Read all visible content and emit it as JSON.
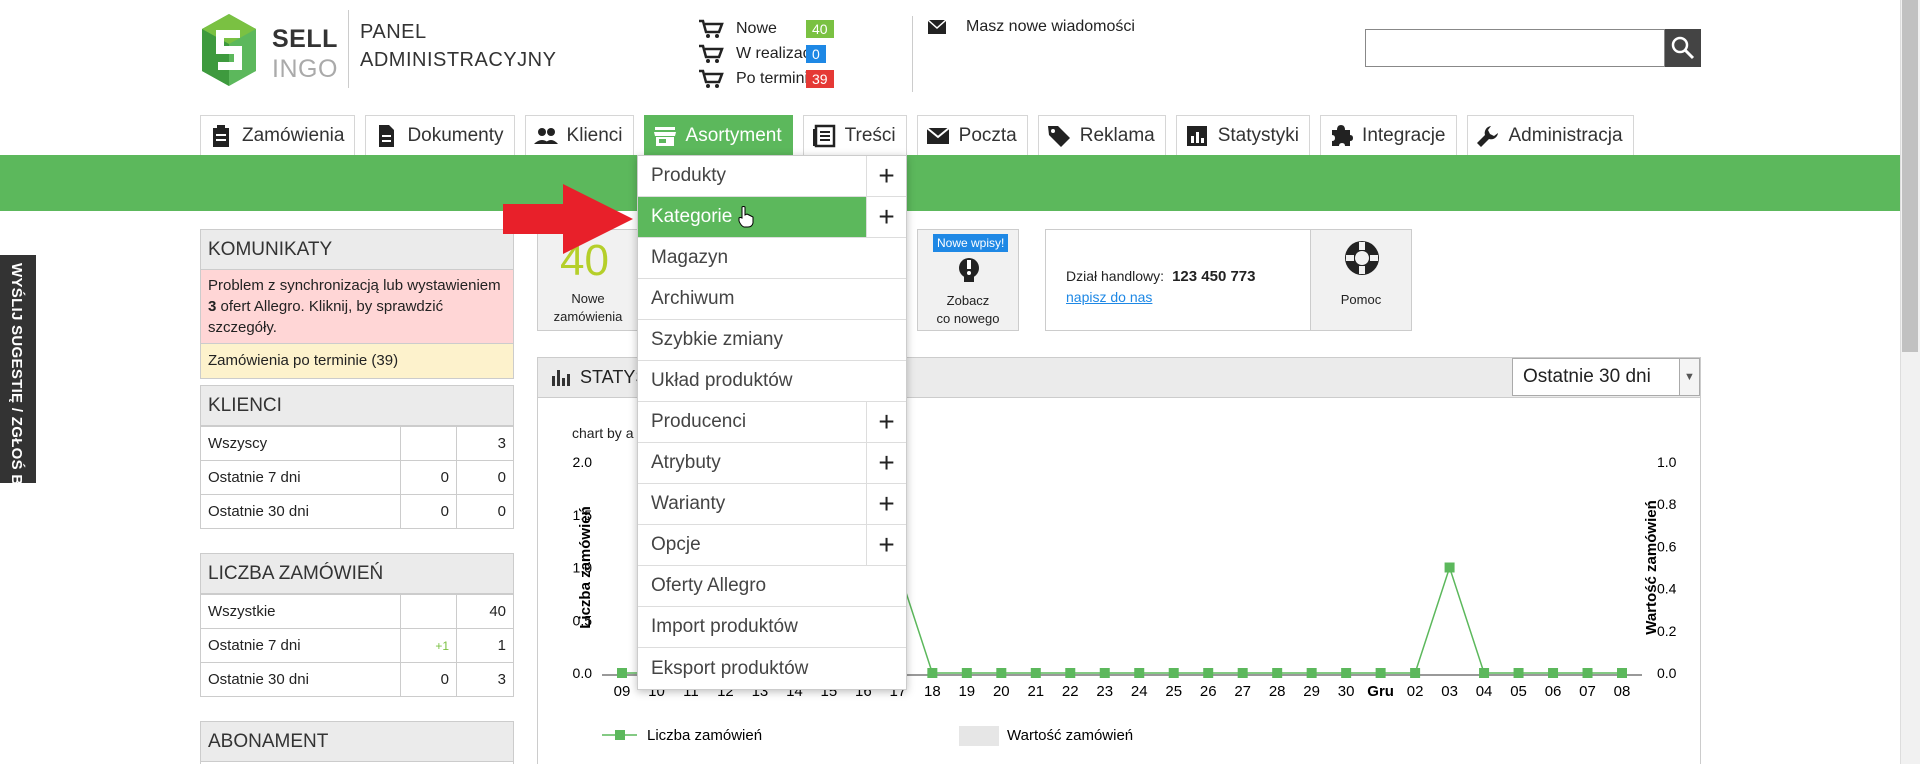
{
  "brand": {
    "logo_line1": "SELL",
    "logo_line2": "INGO",
    "panel_line1": "PANEL",
    "panel_line2": "ADMINISTRACYJNY"
  },
  "order_status": [
    {
      "label": "Nowe",
      "count": "40",
      "color": "#7ac142"
    },
    {
      "label": "W realizacji",
      "count": "0",
      "color": "#1e88e5"
    },
    {
      "label": "Po terminie",
      "count": "39",
      "color": "#e53935"
    }
  ],
  "messages": {
    "text": "Masz nowe wiadomości",
    "icon": "envelope-icon"
  },
  "search": {
    "value": "",
    "placeholder": "",
    "icon": "search-icon"
  },
  "nav": [
    {
      "label": "Zamówienia",
      "icon": "clipboard-icon"
    },
    {
      "label": "Dokumenty",
      "icon": "document-icon"
    },
    {
      "label": "Klienci",
      "icon": "people-icon"
    },
    {
      "label": "Asortyment",
      "icon": "store-icon",
      "active": true
    },
    {
      "label": "Treści",
      "icon": "list-icon"
    },
    {
      "label": "Poczta",
      "icon": "mail-icon"
    },
    {
      "label": "Reklama",
      "icon": "tag-icon"
    },
    {
      "label": "Statystyki",
      "icon": "chart-icon"
    },
    {
      "label": "Integracje",
      "icon": "puzzle-icon"
    },
    {
      "label": "Administracja",
      "icon": "wrench-icon"
    }
  ],
  "side_tab": "WYŚLIJ SUGESTIĘ / ZGŁOŚ BŁĄD",
  "komunikaty": {
    "title": "KOMUNIKATY",
    "alert_pre": "Problem z synchronizacją lub wystawieniem ",
    "alert_num": "3",
    "alert_post": " ofert Allegro. Kliknij, by sprawdzić szczegóły.",
    "overdue": "Zamówienia po terminie (39)"
  },
  "klienci": {
    "title": "KLIENCI",
    "rows": [
      {
        "label": "Wszyscy",
        "delta": "",
        "value": "3"
      },
      {
        "label": "Ostatnie 7 dni",
        "delta": "0",
        "value": "0"
      },
      {
        "label": "Ostatnie 30 dni",
        "delta": "0",
        "value": "0"
      }
    ]
  },
  "liczba_zamowien": {
    "title": "LICZBA ZAMÓWIEŃ",
    "rows": [
      {
        "label": "Wszystkie",
        "delta": "",
        "value": "40"
      },
      {
        "label": "Ostatnie 7 dni",
        "delta": "+1",
        "value": "1"
      },
      {
        "label": "Ostatnie 30 dni",
        "delta": "0",
        "value": "3"
      }
    ]
  },
  "abonament": {
    "title": "ABONAMENT"
  },
  "tiles": {
    "new_orders_count": "40",
    "new_orders_label1": "Nowe",
    "new_orders_label2": "zamówienia",
    "news_badge": "Nowe wpisy!",
    "news_label1": "Zobacz",
    "news_label2": "co nowego",
    "sales_label": "Dział handlowy:",
    "sales_phone": "123 450 773",
    "sales_link": "napisz do nas",
    "help_label": "Pomoc"
  },
  "stats": {
    "title": "STATYSTYKI",
    "range": "Ostatnie 30 dni",
    "chart_caption": "chart by a"
  },
  "dropdown": [
    {
      "label": "Produkty",
      "plus": true
    },
    {
      "label": "Kategorie",
      "plus": true,
      "highlighted": true
    },
    {
      "label": "Magazyn",
      "plus": false
    },
    {
      "label": "Archiwum",
      "plus": false
    },
    {
      "label": "Szybkie zmiany",
      "plus": false
    },
    {
      "label": "Układ produktów",
      "plus": false
    },
    {
      "label": "Producenci",
      "plus": true
    },
    {
      "label": "Atrybuty",
      "plus": true
    },
    {
      "label": "Warianty",
      "plus": true
    },
    {
      "label": "Opcje",
      "plus": true
    },
    {
      "label": "Oferty Allegro",
      "plus": false
    },
    {
      "label": "Import produktów",
      "plus": false
    },
    {
      "label": "Eksport produktów",
      "plus": false
    }
  ],
  "colors": {
    "accent_green": "#5cb85c",
    "arrow_red": "#e8202a",
    "series_green": "#5cb85c"
  },
  "chart_data": {
    "type": "line",
    "x": [
      "09",
      "10",
      "11",
      "12",
      "13",
      "14",
      "15",
      "16",
      "17",
      "18",
      "19",
      "20",
      "21",
      "22",
      "23",
      "24",
      "25",
      "26",
      "27",
      "28",
      "29",
      "30",
      "Gru",
      "02",
      "03",
      "04",
      "05",
      "06",
      "07",
      "08"
    ],
    "series": [
      {
        "name": "Liczba zamówień",
        "axis": "left",
        "values": [
          0,
          0,
          0,
          0,
          0,
          0,
          0,
          0,
          1,
          0,
          0,
          0,
          0,
          0,
          0,
          0,
          0,
          0,
          0,
          0,
          0,
          0,
          0,
          0,
          1,
          0,
          0,
          0,
          0,
          0
        ]
      },
      {
        "name": "Wartość zamówień",
        "axis": "right",
        "values": []
      }
    ],
    "ylabel": "Liczba zamówień",
    "y2label": "Wartość zamówień",
    "ylim": [
      0,
      2
    ],
    "y2lim": [
      0,
      1
    ],
    "yticks": [
      "0.0",
      "0.5",
      "1.0",
      "1.5",
      "2.0"
    ],
    "y2ticks": [
      "0.0",
      "0.2",
      "0.4",
      "0.6",
      "0.8",
      "1.0"
    ],
    "legend": "bottom"
  }
}
